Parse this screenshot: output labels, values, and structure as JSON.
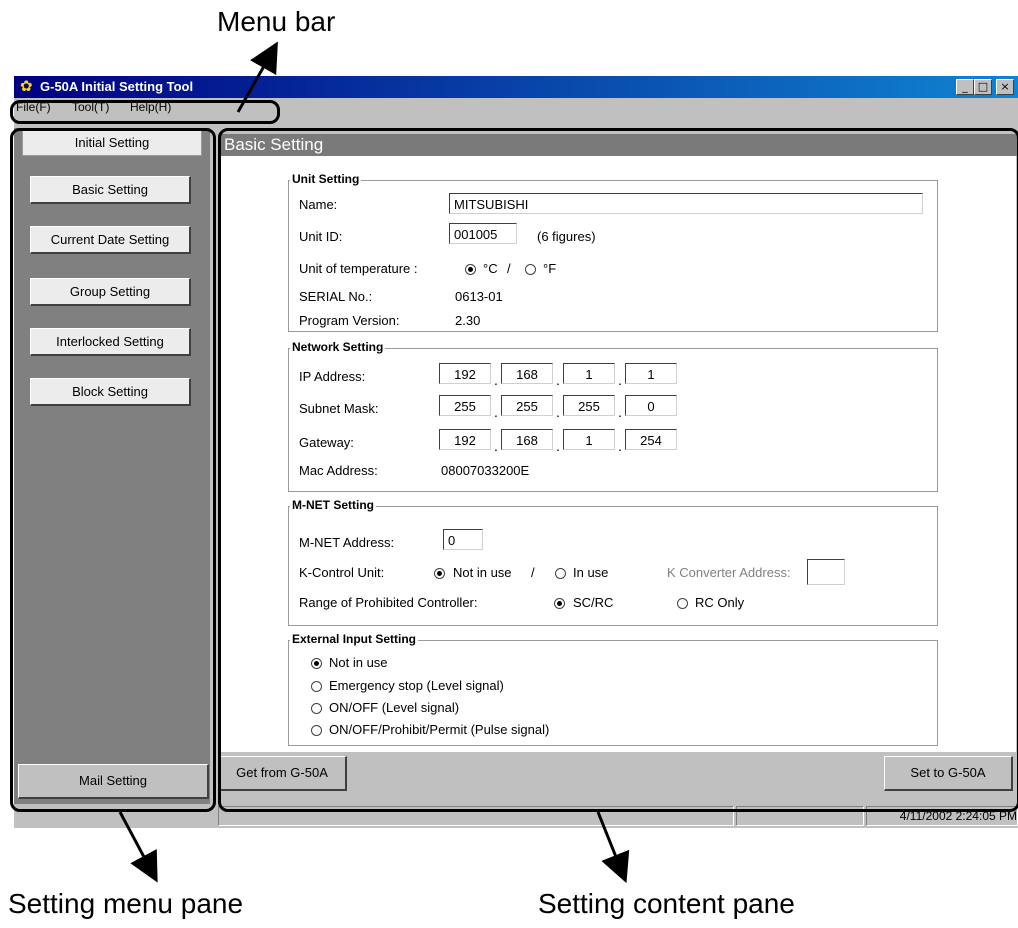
{
  "callouts": {
    "menu_bar": "Menu bar",
    "setting_menu_pane": "Setting menu pane",
    "setting_content_pane": "Setting content pane"
  },
  "window": {
    "title": "G-50A Initial Setting Tool",
    "controls": {
      "minimize": "_",
      "maximize": "□",
      "close": "×"
    }
  },
  "menubar": {
    "items": [
      "File(F)",
      "Tool(T)",
      "Help(H)"
    ]
  },
  "sidebar": {
    "tab": "Initial Setting",
    "items": [
      "Basic Setting",
      "Current Date Setting",
      "Group Setting",
      "Interlocked Setting",
      "Block Setting"
    ],
    "mail": "Mail Setting"
  },
  "content": {
    "title": "Basic Setting",
    "unit": {
      "title": "Unit Setting",
      "name_label": "Name:",
      "name_value": "MITSUBISHI",
      "unitid_label": "Unit ID:",
      "unitid_value": "001005",
      "unitid_hint": "(6 figures)",
      "temp_label": "Unit of temperature :",
      "temp_c": "°C",
      "temp_sep": "/",
      "temp_f": "°F",
      "temp_selected": "°C",
      "serial_label": "SERIAL No.:",
      "serial_value": "0613-01",
      "version_label": "Program Version:",
      "version_value": "2.30"
    },
    "network": {
      "title": "Network Setting",
      "ip_label": "IP Address:",
      "ip": [
        "192",
        "168",
        "1",
        "1"
      ],
      "subnet_label": "Subnet Mask:",
      "subnet": [
        "255",
        "255",
        "255",
        "0"
      ],
      "gateway_label": "Gateway:",
      "gateway": [
        "192",
        "168",
        "1",
        "254"
      ],
      "mac_label": "Mac Address:",
      "mac_value": "08007033200E",
      "dot": "."
    },
    "mnet": {
      "title": "M-NET Setting",
      "address_label": "M-NET Address:",
      "address_value": "0",
      "kcontrol_label": "K-Control Unit:",
      "kcontrol_opt1": "Not in use",
      "kcontrol_sep": "/",
      "kcontrol_opt2": "In use",
      "kcontrol_selected": "Not in use",
      "kconv_label": "K Converter Address:",
      "kconv_value": "",
      "range_label": "Range of Prohibited Controller:",
      "range_opt1": "SC/RC",
      "range_opt2": "RC Only",
      "range_selected": "SC/RC"
    },
    "external": {
      "title": "External Input Setting",
      "options": [
        "Not in use",
        "Emergency stop (Level signal)",
        "ON/OFF (Level signal)",
        "ON/OFF/Prohibit/Permit (Pulse signal)"
      ],
      "selected": "Not in use"
    },
    "get_button": "Get from G-50A",
    "set_button": "Set to G-50A"
  },
  "statusbar": {
    "datetime": "4/11/2002 2:24:05 PM"
  }
}
